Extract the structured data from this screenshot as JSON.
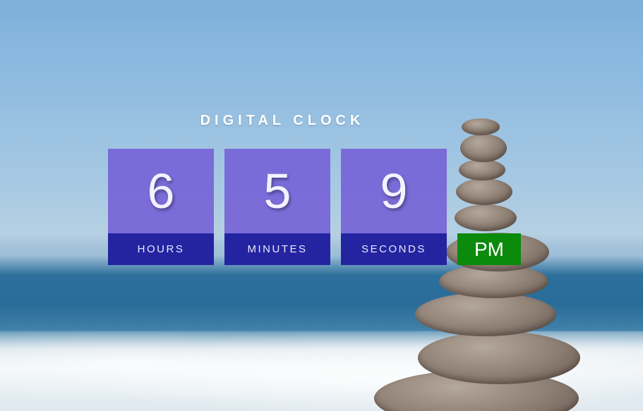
{
  "clock": {
    "title": "DIGITAL CLOCK",
    "hours": {
      "value": "6",
      "label": "HOURS"
    },
    "minutes": {
      "value": "5",
      "label": "MINUTES"
    },
    "seconds": {
      "value": "9",
      "label": "SECONDS"
    },
    "period": "PM"
  },
  "colors": {
    "digit_box": "#7664d7",
    "label_bar": "#2424a0",
    "period_badge": "#0c8a0c",
    "text": "#ffffff"
  }
}
